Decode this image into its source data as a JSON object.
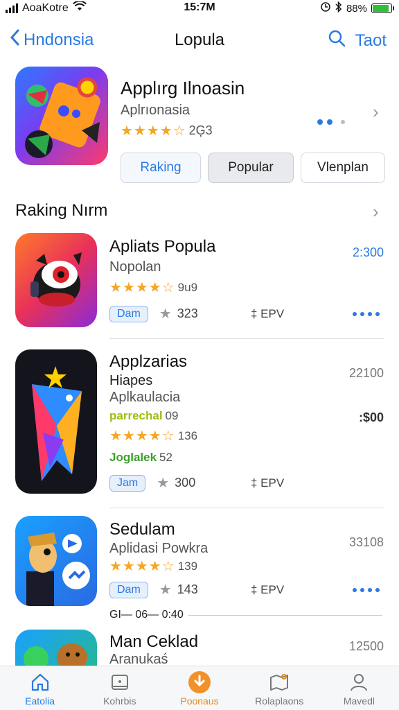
{
  "status": {
    "carrier": "AoaKotre",
    "time": "15:7M",
    "battery": "88%"
  },
  "nav": {
    "back_label": "Hndonsia",
    "title": "Lopula",
    "right_label": "Taot"
  },
  "featured": {
    "title": "Applırg Ilnoasin",
    "subtitle": "Aplrıonasia",
    "stars": "★★★★☆",
    "rating_count": "2Ģ3",
    "buttons": [
      "Raking",
      "Popular",
      "Vlenplan"
    ]
  },
  "section": {
    "title": "Raking Nırm"
  },
  "apps": [
    {
      "title": "Apliats Popula",
      "subtitle": "Nopolan",
      "stars": "★★★★☆",
      "rating": "9u9",
      "price": "2:300",
      "pill": "Dam",
      "count": "323",
      "epv": "‡ EPV"
    },
    {
      "title": "Applzarias",
      "line2": "Hiapes",
      "subtitle": "Aplkaulacia",
      "tag1": "parrechal",
      "tag1_val": "09",
      "stars": "★★★★☆",
      "rating": "136",
      "tag2": "Joglalek",
      "tag2_val": "52",
      "price": "22100",
      "price2": ":$00",
      "pill": "Jam",
      "count": "300",
      "epv": "‡ EPV"
    },
    {
      "title": "Sedulam",
      "subtitle": "Aplidasi Powkra",
      "stars": "★★★★☆",
      "rating": "139",
      "price": "33108",
      "pill": "Dam",
      "count": "143",
      "epv": "‡ EPV",
      "footer": "GI— 06— 0:40"
    },
    {
      "title": "Man Ceklad",
      "subtitle": "Aranukaś",
      "price": "12500"
    }
  ],
  "tabs": [
    {
      "label": "Eatolia",
      "icon": "home-icon"
    },
    {
      "label": "Kohrbis",
      "icon": "card-icon"
    },
    {
      "label": "Poonaus",
      "icon": "download-icon"
    },
    {
      "label": "Rolaplaons",
      "icon": "map-icon"
    },
    {
      "label": "Mavedl",
      "icon": "person-icon"
    }
  ],
  "colors": {
    "accent": "#2a7ae2",
    "star": "#f5a623",
    "tab_featured": "#e08a1a"
  }
}
